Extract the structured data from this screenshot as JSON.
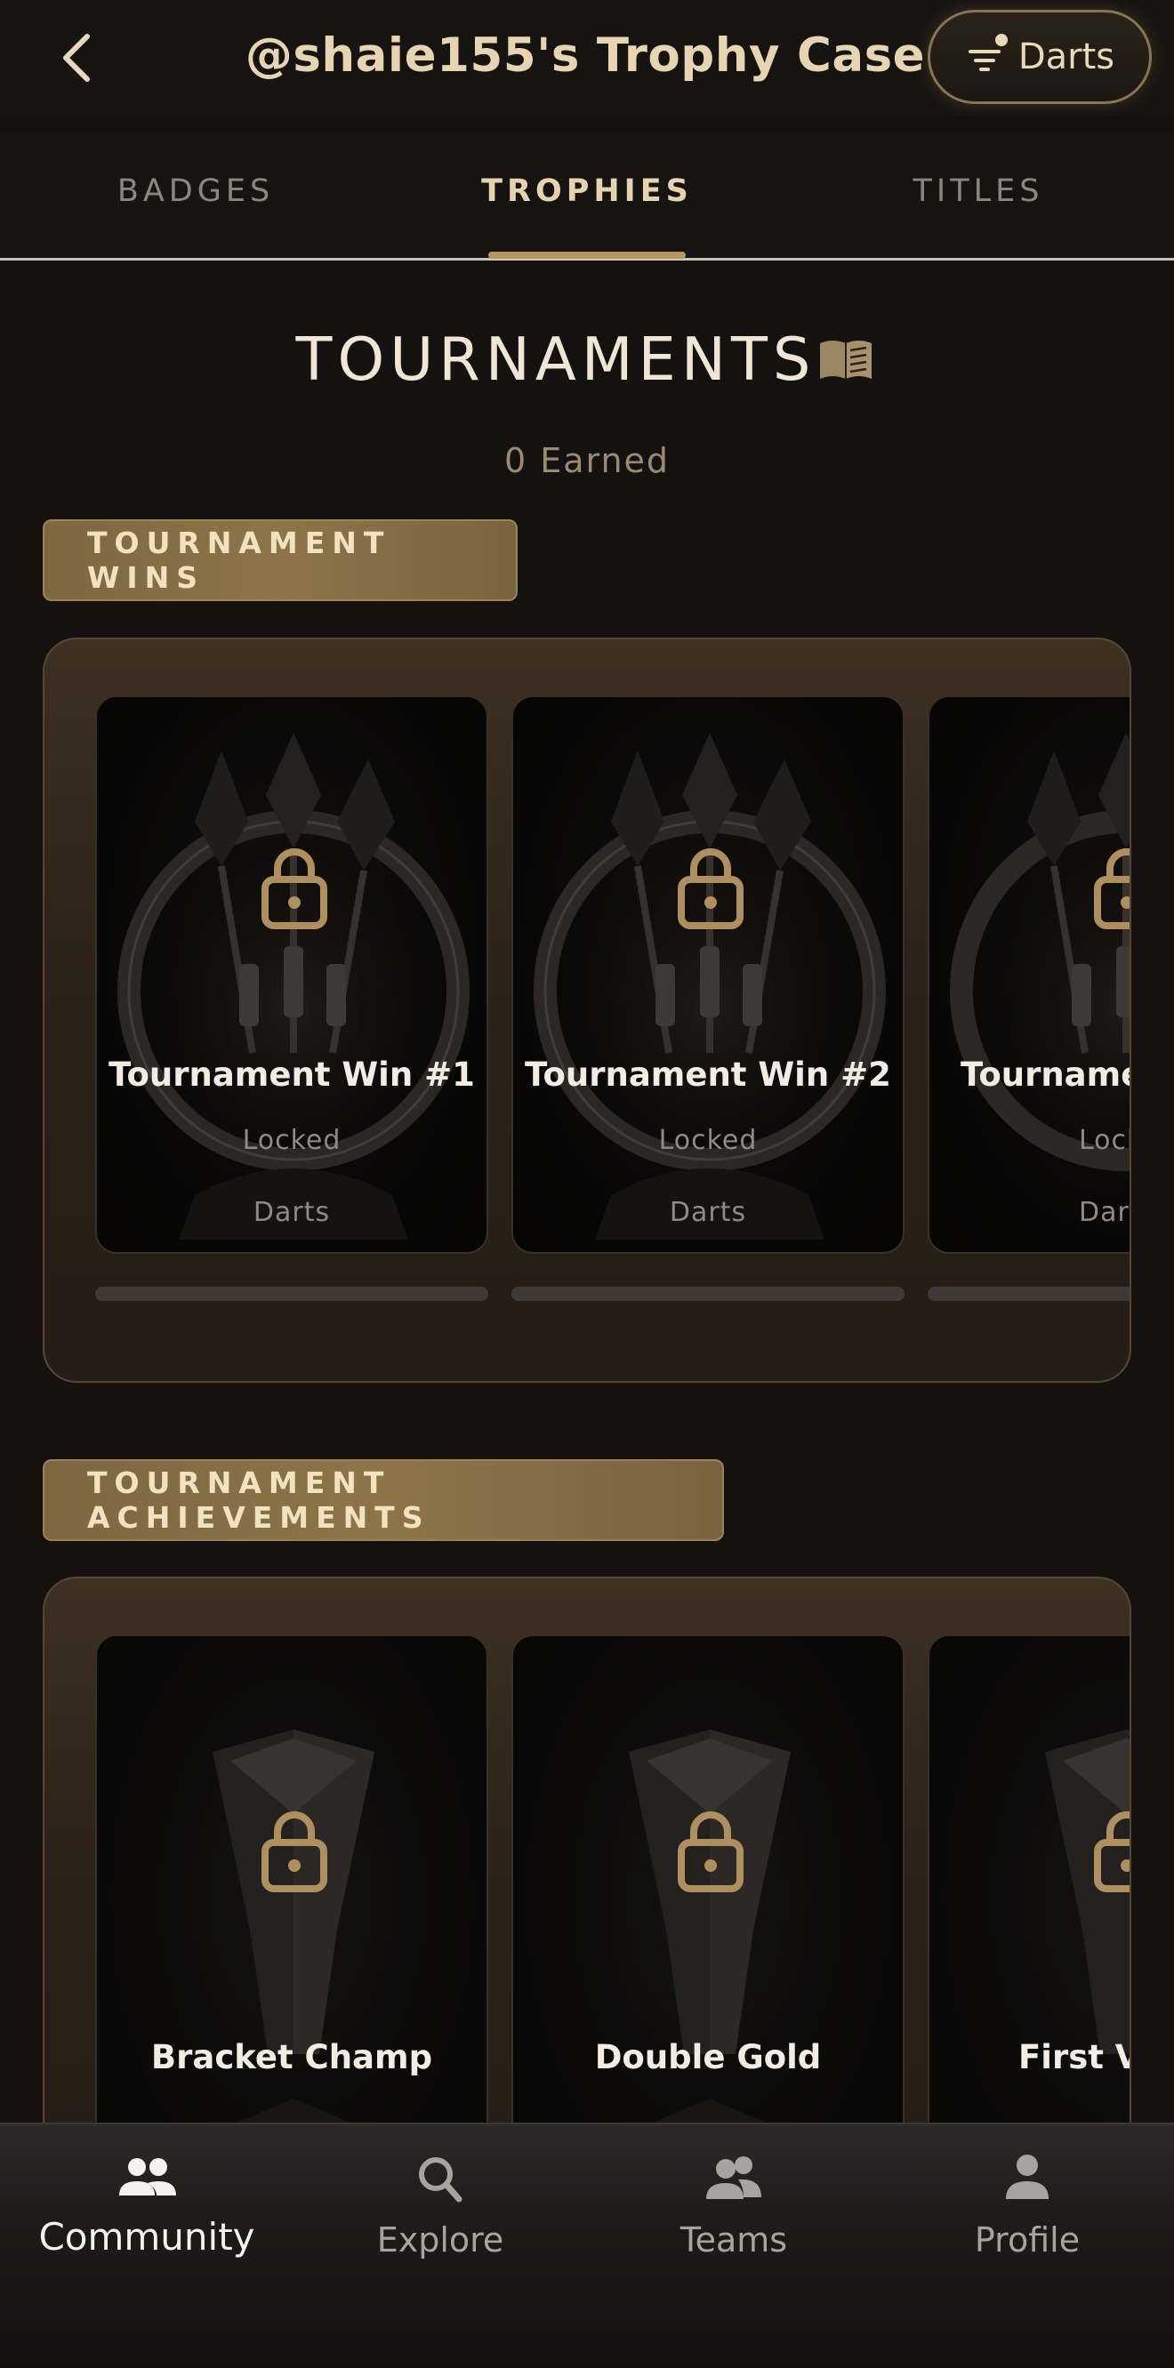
{
  "header": {
    "title": "@shaie155's Trophy Case",
    "filter_label": "Darts",
    "back_icon": "chevron-left-icon",
    "filter_icon": "filter-icon"
  },
  "tabs": [
    {
      "label": "BADGES",
      "active": false
    },
    {
      "label": "TROPHIES",
      "active": true
    },
    {
      "label": "TITLES",
      "active": false
    }
  ],
  "section": {
    "title": "TOURNAMENTS",
    "info_icon": "book-icon",
    "earned": "0 Earned"
  },
  "categories": [
    {
      "label": "TOURNAMENT WINS",
      "items": [
        {
          "title": "Tournament Win #1",
          "status": "Locked",
          "sport": "Darts",
          "progress": 0
        },
        {
          "title": "Tournament Win #2",
          "status": "Locked",
          "sport": "Darts",
          "progress": 0
        },
        {
          "title": "Tourname",
          "status": "Lock",
          "sport": "Dar",
          "progress": 0
        }
      ]
    },
    {
      "label": "TOURNAMENT ACHIEVEMENTS",
      "items": [
        {
          "title": "Bracket Champ"
        },
        {
          "title": "Double Gold"
        },
        {
          "title": "First V"
        }
      ]
    }
  ],
  "bottom_nav": [
    {
      "label": "Community",
      "icon": "community-icon",
      "active": true
    },
    {
      "label": "Explore",
      "icon": "search-icon",
      "active": false
    },
    {
      "label": "Teams",
      "icon": "teams-icon",
      "active": false
    },
    {
      "label": "Profile",
      "icon": "profile-icon",
      "active": false
    }
  ],
  "colors": {
    "background": "#141210",
    "accent_gold": "#b5975d",
    "chip_gold": "#8d7548",
    "text_light": "#f2ece3",
    "text_muted": "#8e8a84"
  }
}
